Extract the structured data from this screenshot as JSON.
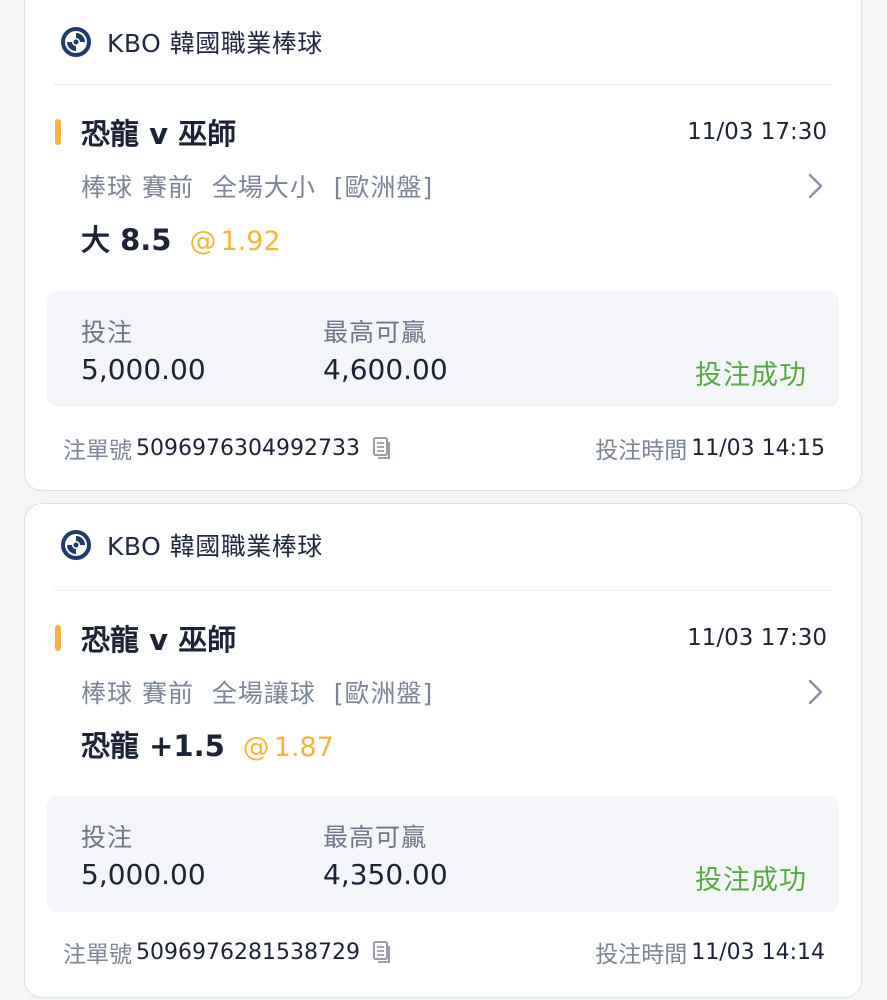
{
  "bets": [
    {
      "league": "KBO 韓國職業棒球",
      "match": "恐龍 v 巫師",
      "match_time": "11/03 17:30",
      "market": "棒球 賽前  全場大小  [歐洲盤]",
      "pick": "大 8.5",
      "odds_at": "@",
      "odds": "1.92",
      "stake_label": "投注",
      "stake": "5,000.00",
      "max_win_label": "最高可贏",
      "max_win": "4,600.00",
      "status": "投注成功",
      "order_label": "注單號",
      "order_no": "5096976304992733",
      "bet_time_label": "投注時間",
      "bet_time": "11/03 14:15"
    },
    {
      "league": "KBO 韓國職業棒球",
      "match": "恐龍 v 巫師",
      "match_time": "11/03 17:30",
      "market": "棒球 賽前  全場讓球  [歐洲盤]",
      "pick": "恐龍 +1.5",
      "odds_at": "@",
      "odds": "1.87",
      "stake_label": "投注",
      "stake": "5,000.00",
      "max_win_label": "最高可贏",
      "max_win": "4,350.00",
      "status": "投注成功",
      "order_label": "注單號",
      "order_no": "5096976281538729",
      "bet_time_label": "投注時間",
      "bet_time": "11/03 14:14"
    }
  ],
  "colors": {
    "accent": "#f3b63c",
    "success": "#59a842",
    "logo": "#1f3b6e"
  },
  "icons": {
    "league_logo": "kbo-logo-icon",
    "chevron": "chevron-right-icon",
    "copy": "copy-icon"
  }
}
